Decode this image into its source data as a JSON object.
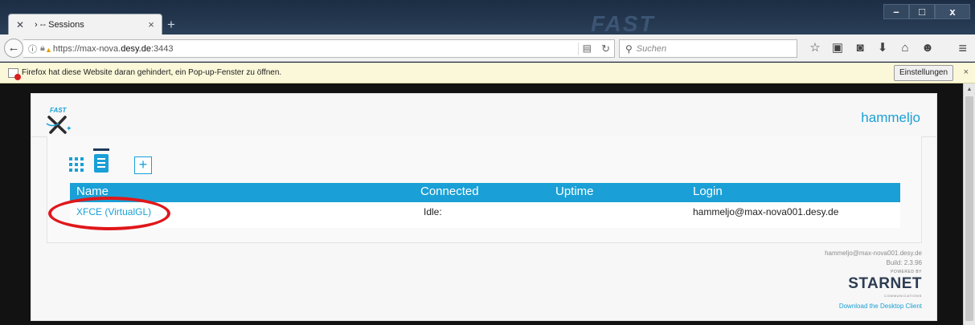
{
  "window": {
    "tab_title": "› -- Sessions",
    "tab_close": "×",
    "new_tab": "+",
    "watermark": "FAST",
    "controls": {
      "minimize": "–",
      "maximize": "□",
      "close": "x"
    }
  },
  "navbar": {
    "back": "←",
    "url_prefix": "https://max-nova.",
    "url_domain": "desy.de",
    "url_suffix": ":3443",
    "search_placeholder": "Suchen"
  },
  "notification": {
    "message": "Firefox hat diese Website daran gehindert, ein Pop-up-Fenster zu öffnen.",
    "settings_label": "Einstellungen",
    "close": "×"
  },
  "app": {
    "username": "hammeljo",
    "add_label": "+",
    "table": {
      "headers": [
        "Name",
        "Connected",
        "Uptime",
        "Login"
      ],
      "rows": [
        {
          "name": "XFCE (VirtualGL)",
          "connected": "Idle:",
          "uptime": "",
          "login": "hammeljo@max-nova001.desy.de"
        }
      ]
    },
    "footer": {
      "user_host": "hammeljo@max-nova001.desy.de",
      "build": "Build: 2.3.96",
      "powered_by": "POWERED BY",
      "brand": "STARNET",
      "brand_sub": "COMMUNICATIONS",
      "download": "Download the Desktop Client"
    }
  },
  "colors": {
    "accent": "#1aa0d6",
    "annotation": "#e0171a",
    "notification_bg": "#fbf8d9"
  }
}
